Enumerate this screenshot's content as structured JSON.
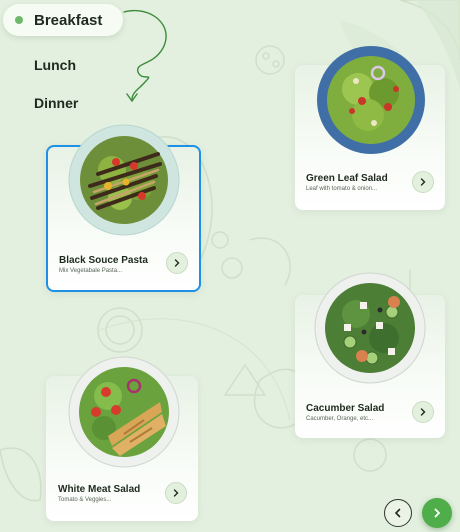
{
  "menu": {
    "tabs": [
      {
        "label": "Breakfast",
        "active": true
      },
      {
        "label": "Lunch",
        "active": false
      },
      {
        "label": "Dinner",
        "active": false
      }
    ]
  },
  "cards": [
    {
      "title": "Black Souce Pasta",
      "subtitle": "Mix Vegetabale Pasta...",
      "selected": true
    },
    {
      "title": "Green Leaf Salad",
      "subtitle": "Leaf with tomato & onion...",
      "selected": false
    },
    {
      "title": "Cacumber  Salad",
      "subtitle": "Cacumber, Orange, etc...",
      "selected": false
    },
    {
      "title": "White Meat Salad",
      "subtitle": "Tomato & Veggies...",
      "selected": false
    }
  ],
  "colors": {
    "background": "#e3efdf",
    "accent": "#4fae4a",
    "selection": "#1e90e6"
  },
  "icons": {
    "card_button": "chevron-right-icon",
    "prev": "chevron-left-icon",
    "next": "chevron-right-icon"
  }
}
